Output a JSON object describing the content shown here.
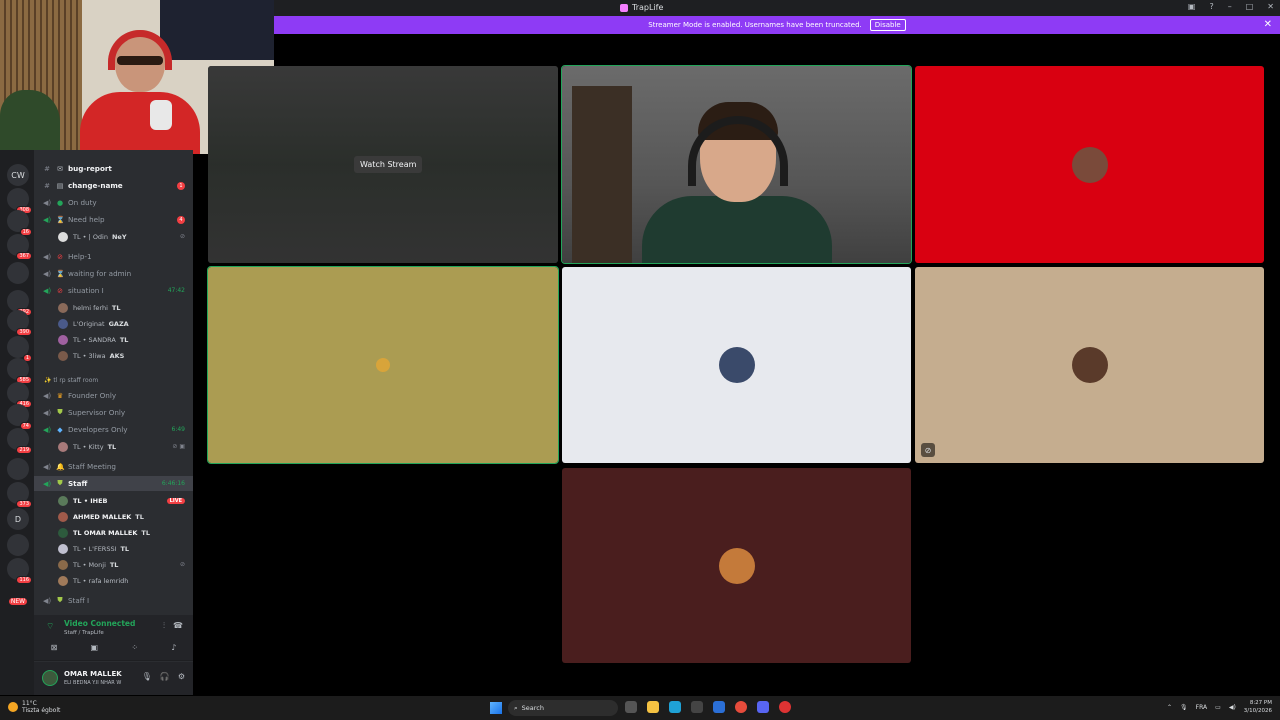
{
  "window": {
    "title": "TrapLife"
  },
  "streamer_bar": {
    "message": "Streamer Mode is enabled. Usernames have been truncated.",
    "disable_label": "Disable"
  },
  "servers": [
    {
      "label": "CW",
      "badge": ""
    },
    {
      "label": "",
      "badge": "308"
    },
    {
      "label": "",
      "badge": "16"
    },
    {
      "label": "",
      "badge": "367"
    },
    {
      "label": "",
      "badge": ""
    },
    {
      "label": "",
      "badge": "292"
    },
    {
      "label": "",
      "badge": "390"
    },
    {
      "label": "",
      "badge": "1"
    },
    {
      "label": "",
      "badge": "585"
    },
    {
      "label": "",
      "badge": "416"
    },
    {
      "label": "",
      "badge": "74"
    },
    {
      "label": "",
      "badge": "219"
    },
    {
      "label": "",
      "badge": ""
    },
    {
      "label": "",
      "badge": "373"
    },
    {
      "label": "D",
      "badge": ""
    },
    {
      "label": "",
      "badge": ""
    },
    {
      "label": "",
      "badge": "116"
    },
    {
      "label": "",
      "badge": "NEW"
    }
  ],
  "channels": {
    "bug_report": "bug-report",
    "change_name": "change-name",
    "change_name_mentions": "1",
    "on_duty": "On duty",
    "need_help": "Need help",
    "need_help_mentions": "4",
    "need_help_user": "TL • | Odin",
    "need_help_user_tag": "NeY",
    "help_1": "Help-1",
    "waiting": "waiting for admin",
    "situation": "situation I",
    "situation_time": "47:42",
    "situation_users": [
      "helmi ferhi",
      "L'Originat",
      "TL • SANDRA",
      "TL • 3liwa"
    ],
    "situation_tags": [
      "TL",
      "GAZA",
      "TL",
      "AKS"
    ],
    "staff_room": "tl rp staff room",
    "founder_only": "Founder Only",
    "supervisor_only": "Supervisor Only",
    "developers_only": "Developers Only",
    "developers_time": "6:49",
    "developers_user": "TL • Kitty",
    "developers_user_tag": "TL",
    "staff_meeting": "Staff Meeting",
    "staff": "Staff",
    "staff_time": "6:46:16",
    "staff_users": [
      "TL • IHEB",
      "AHMED MALLEK",
      "TL OMAR MALLEK",
      "TL • L'FERSSI",
      "TL • Monji",
      "TL • rafa lemridh"
    ],
    "staff_tags": [
      "",
      "TL",
      "TL",
      "TL",
      "TL",
      ""
    ],
    "live_label": "LIVE",
    "staff_1": "Staff I"
  },
  "voice": {
    "status": "Video Connected",
    "location": "Staff / TrapLife"
  },
  "user": {
    "name": "OMAR MALLEK",
    "status": "ELI BEDNA Y.II NHAR W"
  },
  "stage": {
    "watch_stream_label": "Watch Stream"
  },
  "taskbar": {
    "temperature": "11°C",
    "weather": "Tiszta égbolt",
    "search_placeholder": "Search",
    "language": "FRA",
    "time": "8:27 PM",
    "date": "3/10/2026"
  },
  "colors": {
    "streamer_bar": "#8e3bf5",
    "speaking_outline": "#23a55a",
    "tile_red": "#d90011",
    "tile_olive": "#ab9c52",
    "tile_light": "#e7e9ee",
    "tile_tan": "#c5ad8f",
    "tile_maroon": "#4a1e1e"
  }
}
